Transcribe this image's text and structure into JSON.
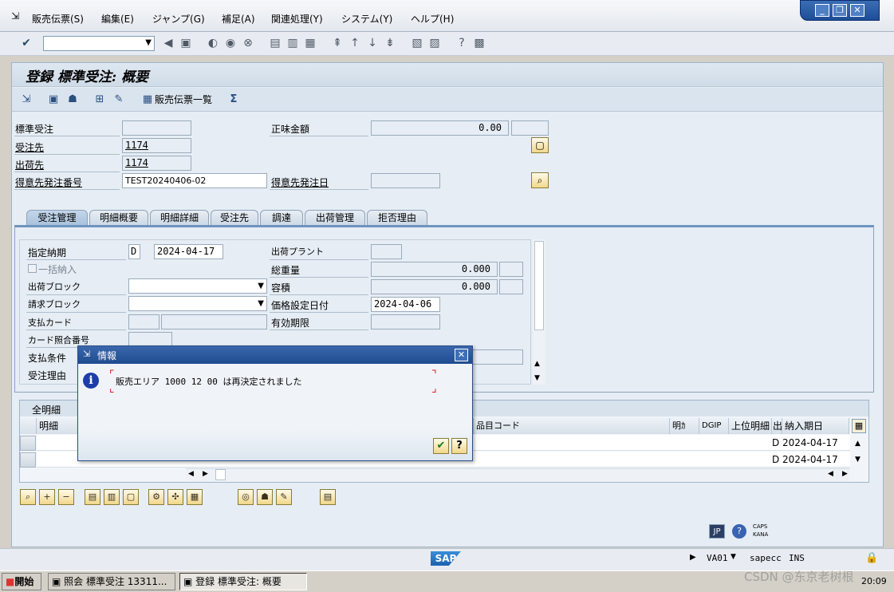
{
  "menu": [
    "販売伝票(S)",
    "編集(E)",
    "ジャンプ(G)",
    "補足(A)",
    "関連処理(Y)",
    "システム(Y)",
    "ヘルプ(H)"
  ],
  "window_controls": {
    "minimize": "_",
    "restore": "❐",
    "close": "✕"
  },
  "screen_title": "登録 標準受注: 概要",
  "app_toolbar": {
    "order_list": "販売伝票一覧"
  },
  "header": {
    "std_order_label": "標準受注",
    "std_order_value": "",
    "net_value_label": "正味金額",
    "net_value": "0.00",
    "currency": "",
    "sold_to_label": "受注先",
    "sold_to": "1174",
    "ship_to_label": "出荷先",
    "ship_to": "1174",
    "po_number_label": "得意先発注番号",
    "po_number": "TEST20240406-02",
    "po_date_label": "得意先発注日",
    "po_date": ""
  },
  "tabs": [
    "受注管理",
    "明細概要",
    "明細詳細",
    "受注先",
    "調達",
    "出荷管理",
    "拒否理由"
  ],
  "active_tab": 0,
  "order_mgmt": {
    "req_delivery_label": "指定納期",
    "req_delivery_format": "D",
    "req_delivery_date": "2024-04-17",
    "plant_label": "出荷プラント",
    "plant": "",
    "complete_delivery_label": "一括納入",
    "gross_weight_label": "総重量",
    "gross_weight": "0.000",
    "weight_unit": "",
    "delivery_block_label": "出荷ブロック",
    "volume_label": "容積",
    "volume": "0.000",
    "volume_unit": "",
    "billing_block_label": "請求ブロック",
    "pricing_date_label": "価格設定日付",
    "pricing_date": "2024-04-06",
    "payment_card_label": "支払カード",
    "valid_to_label": "有効期限",
    "card_verif_label": "カード照合番号",
    "payment_terms_label": "支払条件",
    "order_reason_label": "受注理由"
  },
  "items_table": {
    "title": "全明細",
    "columns": [
      "明細",
      "品目コード",
      "明ｶ",
      "DGIP",
      "上位明細",
      "出",
      "納入期日"
    ],
    "rows": [
      {
        "delivery_flag": "D",
        "delivery_date": "2024-04-17"
      },
      {
        "delivery_flag": "D",
        "delivery_date": "2024-04-17"
      }
    ]
  },
  "dialog": {
    "title": "情報",
    "message": "販売エリア 1000 12 00 は再決定されました",
    "close": "✕"
  },
  "status_bar": {
    "language": "JP",
    "caps": "CAPS",
    "kana": "KANA",
    "tcode": "VA01",
    "server": "sapecc",
    "mode": "INS"
  },
  "taskbar": {
    "start": "開始",
    "task1": "照会 標準受注 13311...",
    "task2": "登録 標準受注: 概要",
    "clock": "20:09",
    "watermark": "CSDN @东京老树根"
  },
  "colors": {
    "accent": "#1f4b8f",
    "title_bg": "#dfe8f1",
    "field_border": "#9aabbd"
  }
}
